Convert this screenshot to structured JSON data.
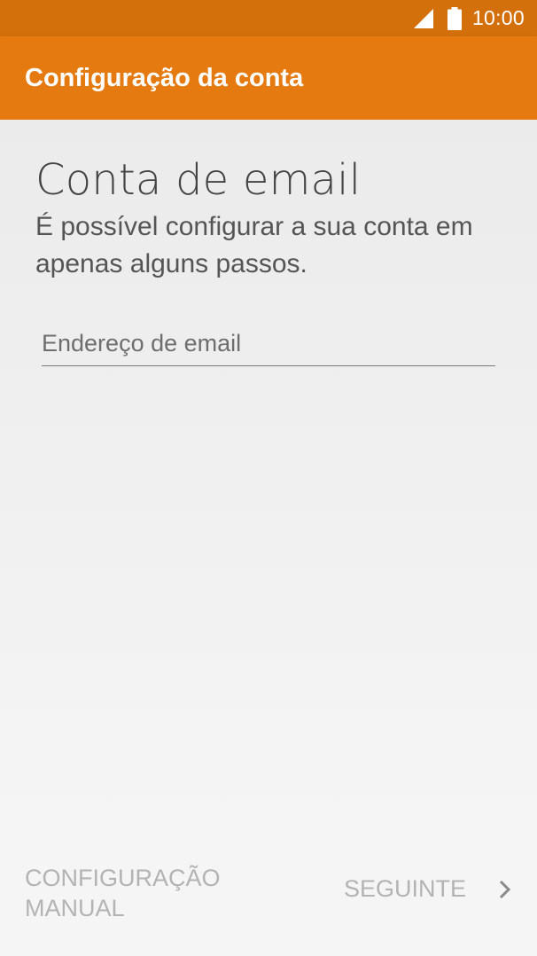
{
  "status_bar": {
    "time": "10:00",
    "icons": [
      "signal-icon",
      "battery-icon"
    ]
  },
  "app_bar": {
    "title": "Configuração da conta"
  },
  "content": {
    "heading": "Conta de email",
    "description": "É possível configurar a sua conta em apenas alguns passos.",
    "email_field": {
      "value": "",
      "placeholder": "Endereço de email"
    }
  },
  "bottom_bar": {
    "manual_label": "CONFIGURAÇÃO MANUAL",
    "next_label": "SEGUINTE",
    "next_icon": "chevron-right-icon"
  },
  "colors": {
    "status_bar": "#d4700b",
    "app_bar": "#e57a10",
    "disabled_text": "#b3b3b3"
  }
}
